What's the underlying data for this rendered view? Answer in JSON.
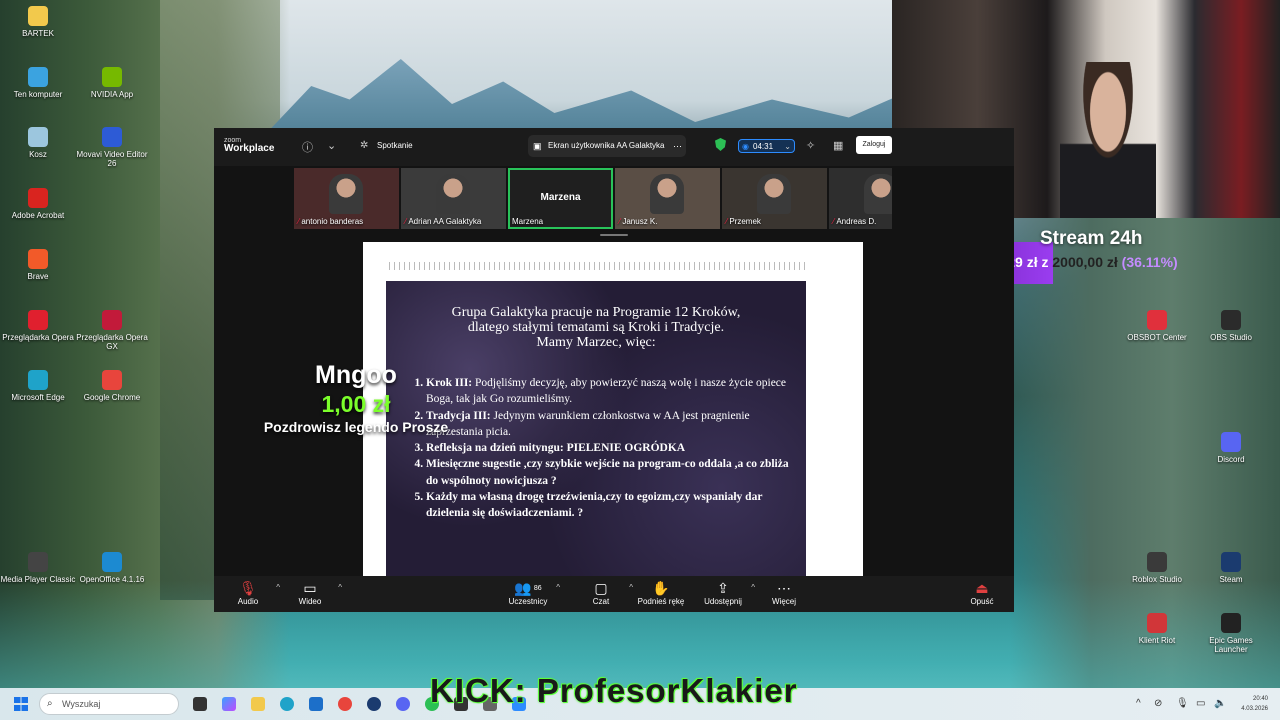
{
  "desktop": {
    "icons_left": [
      {
        "label": "BARTEK",
        "icon": "folder-icon",
        "color": "#f2c94c"
      },
      {
        "label": "Ten komputer",
        "icon": "computer-icon",
        "color": "#3ba3e0"
      },
      {
        "label": "NVIDIA App",
        "icon": "nvidia-icon",
        "color": "#76b900"
      },
      {
        "label": "Kosz",
        "icon": "recycle-bin-icon",
        "color": "#9cc6de"
      },
      {
        "label": "Movavi Video Editor 26",
        "icon": "movavi-icon",
        "color": "#2d5bd6"
      },
      {
        "label": "Adobe Acrobat",
        "icon": "acrobat-icon",
        "color": "#d9241f"
      },
      {
        "label": "Brave",
        "icon": "brave-icon",
        "color": "#f25a29"
      },
      {
        "label": "Przeglądarka Opera",
        "icon": "opera-icon",
        "color": "#e0202e"
      },
      {
        "label": "Przeglądarka Opera GX",
        "icon": "opera-gx-icon",
        "color": "#c21a3a"
      },
      {
        "label": "Microsoft Edge",
        "icon": "edge-icon",
        "color": "#1fa3c9"
      },
      {
        "label": "Google Chrome",
        "icon": "chrome-icon",
        "color": "#e8453c"
      },
      {
        "label": "Media Player Classic",
        "icon": "mpc-icon",
        "color": "#444444"
      },
      {
        "label": "OpenOffice 4.1.16",
        "icon": "openoffice-icon",
        "color": "#1c8ad1"
      }
    ],
    "icons_right": [
      {
        "label": "OBSBOT Center",
        "icon": "obsbot-icon",
        "color": "#e0303c"
      },
      {
        "label": "OBS Studio",
        "icon": "obs-icon",
        "color": "#2b2b2b"
      },
      {
        "label": "Discord",
        "icon": "discord-icon",
        "color": "#5865f2"
      },
      {
        "label": "Roblox Studio",
        "icon": "roblox-icon",
        "color": "#3a3a3a"
      },
      {
        "label": "Steam",
        "icon": "steam-icon",
        "color": "#1b3b6f"
      },
      {
        "label": "Klient Riot",
        "icon": "riot-icon",
        "color": "#d13639"
      },
      {
        "label": "Epic Games Launcher",
        "icon": "epic-icon",
        "color": "#222222"
      }
    ]
  },
  "stream_goal": {
    "title": "Stream 24h",
    "current": "722,29 zł",
    "z": "z",
    "target": "2000,00 zł",
    "percent_text": "(36.11%)",
    "progress": 0.3611
  },
  "zoom": {
    "brand_top": "zoom",
    "brand": "Workplace",
    "meeting_label": "Spotkanie",
    "share_label": "Ekran użytkownika AA Galaktyka",
    "timer": "04:31",
    "login_label": "Zaloguj",
    "participants": [
      {
        "name": "antonio banderas",
        "muted": true,
        "bg": "#4a2a2a"
      },
      {
        "name": "Adrian AA Galaktyka",
        "muted": true,
        "bg": "#3b3b3b"
      },
      {
        "name": "Marzena",
        "muted": false,
        "bg": "#1f1f1f",
        "active": true,
        "big": "Marzena"
      },
      {
        "name": "Janusz K.",
        "muted": true,
        "bg": "#5a4e45"
      },
      {
        "name": "Przemek",
        "muted": true,
        "bg": "#3a3530"
      },
      {
        "name": "Andreas D.",
        "muted": true,
        "bg": "#2e2e2e"
      }
    ],
    "slide": {
      "heading_lines": [
        "Grupa Galaktyka pracuje na Programie 12 Kroków,",
        "dlatego stałymi tematami są Kroki i Tradycje.",
        "Mamy Marzec, więc:"
      ],
      "items": [
        {
          "lead": "Krok III:",
          "text": " Podjęliśmy decyzję, aby powierzyć naszą wolę i nasze życie opiece Boga, tak jak Go rozumieliśmy."
        },
        {
          "lead": "Tradycja III:",
          "text": " Jedynym warunkiem członkostwa w AA jest pragnienie zaprzestania picia."
        },
        {
          "lead": "Refleksja na dzień mityngu:",
          "text": " PIELENIE OGRÓDKA"
        },
        {
          "lead": "",
          "text": " Miesięczne sugestie ,czy szybkie wejście na program-co oddala ,a co zbliża do wspólnoty nowicjusza ?"
        },
        {
          "lead": "",
          "text": "Każdy ma własną drogę trzeźwienia,czy to egoizm,czy wspaniały dar dzielenia się doświadczeniami. ?"
        }
      ]
    },
    "toolbar": {
      "audio": "Audio",
      "video": "Wideo",
      "participants": "Uczestnicy",
      "participants_count": "86",
      "chat": "Czat",
      "raise_hand": "Podnieś rękę",
      "share": "Udostępnij",
      "more": "Więcej",
      "leave": "Opuść"
    }
  },
  "donation": {
    "name": "Mngoo",
    "amount": "1,00 zł",
    "message": "Pozdrowisz legendo Prosze"
  },
  "kick_banner": "KICK: ProfesorKlakier",
  "taskbar": {
    "search_placeholder": "Wyszukaj",
    "time": "20:40",
    "date": "4.03.2026"
  }
}
